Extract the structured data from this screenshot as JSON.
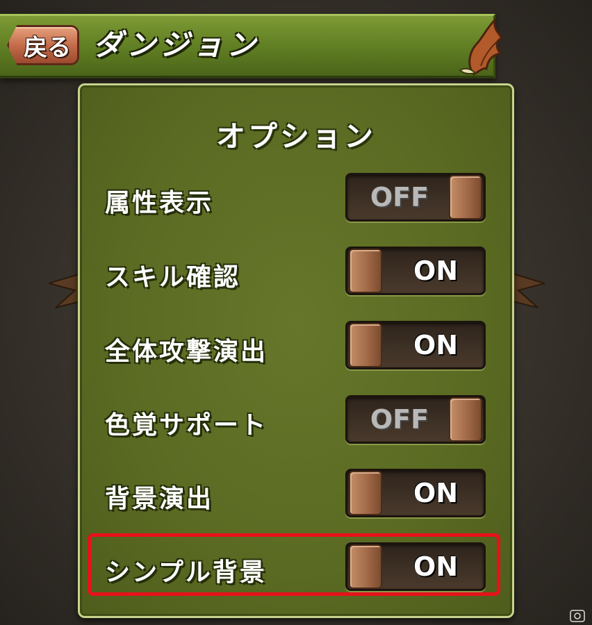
{
  "header": {
    "back_label": "戻る",
    "title": "ダンジョン"
  },
  "panel": {
    "title": "オプション",
    "options": [
      {
        "label": "属性表示",
        "state": "OFF"
      },
      {
        "label": "スキル確認",
        "state": "ON"
      },
      {
        "label": "全体攻撃演出",
        "state": "ON"
      },
      {
        "label": "色覚サポート",
        "state": "OFF"
      },
      {
        "label": "背景演出",
        "state": "ON"
      },
      {
        "label": "シンプル背景",
        "state": "ON",
        "highlighted": true
      }
    ]
  },
  "colors": {
    "header_green": "#6b8a28",
    "panel_green": "#5e6e24",
    "toggle_track": "#3a2d22",
    "knob_brown": "#a26a48",
    "highlight_red": "#e8111a"
  }
}
